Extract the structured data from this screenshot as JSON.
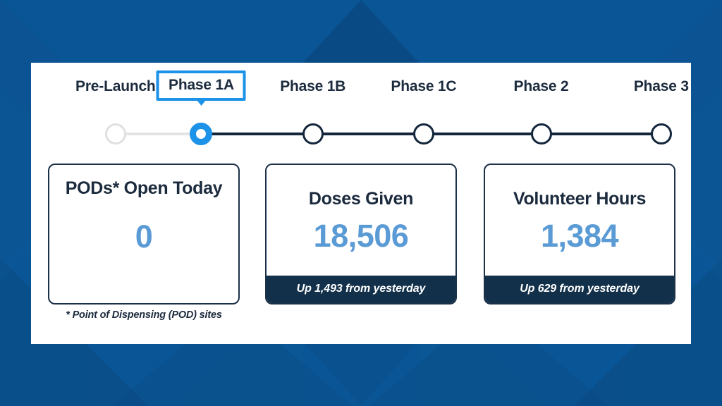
{
  "theme": {
    "background_blue": "#0a5596",
    "background_blue_dark": "#0d4a80",
    "panel_white": "#ffffff",
    "accent_blue": "#1c92e8",
    "value_blue": "#5b9bd5",
    "navy": "#12304a",
    "text_navy": "#1b2a3d",
    "inactive_gray": "#e3e3e3"
  },
  "timeline": {
    "phases": [
      {
        "label": "Pre-Launch",
        "state": "past",
        "x_pct": 12.8
      },
      {
        "label": "Phase 1A",
        "state": "current",
        "x_pct": 25.8
      },
      {
        "label": "Phase 1B",
        "state": "future",
        "x_pct": 42.7
      },
      {
        "label": "Phase 1C",
        "state": "future",
        "x_pct": 59.5
      },
      {
        "label": "Phase 2",
        "state": "future",
        "x_pct": 77.3
      },
      {
        "label": "Phase  3",
        "state": "future",
        "x_pct": 95.5
      }
    ]
  },
  "cards": [
    {
      "id": "pods-open-today",
      "title": "PODs* Open Today",
      "value": "0",
      "footer": null,
      "footnote": "* Point of Dispensing (POD) sites"
    },
    {
      "id": "doses-given",
      "title": "Doses Given",
      "value": "18,506",
      "footer": "Up 1,493 from yesterday",
      "footnote": null
    },
    {
      "id": "volunteer-hours",
      "title": "Volunteer Hours",
      "value": "1,384",
      "footer": "Up 629 from yesterday",
      "footnote": null
    }
  ]
}
